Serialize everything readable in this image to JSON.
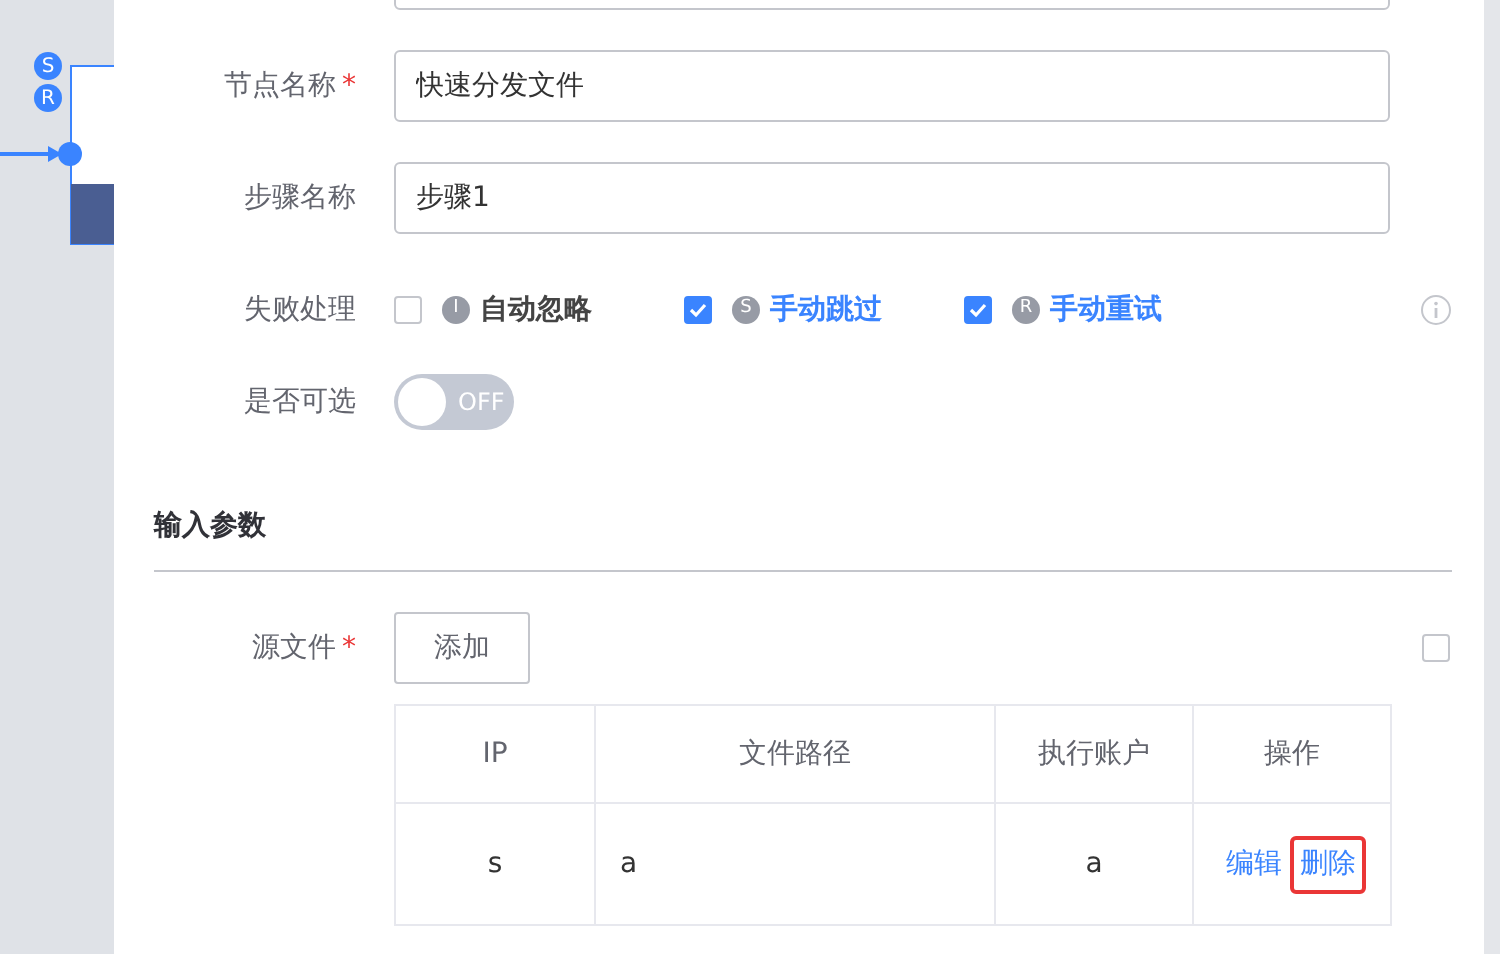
{
  "canvas": {
    "node_badges": [
      "S",
      "R"
    ]
  },
  "form": {
    "fields": [
      {
        "label": "节点名称",
        "required_mark": "*",
        "value": "快速分发文件"
      },
      {
        "label": "步骤名称",
        "value": "步骤1"
      }
    ],
    "failure": {
      "label": "失败处理",
      "options": [
        {
          "badge": "I",
          "label": "自动忽略",
          "checked": false
        },
        {
          "badge": "S",
          "label": "手动跳过",
          "checked": true
        },
        {
          "badge": "R",
          "label": "手动重试",
          "checked": true
        }
      ]
    },
    "optional": {
      "label": "是否可选",
      "on": false,
      "text": "OFF"
    }
  },
  "input_section": {
    "title": "输入参数",
    "source": {
      "label": "源文件",
      "required_mark": "*",
      "add_button": "添加",
      "checked": false
    },
    "table": {
      "columns": [
        "IP",
        "文件路径",
        "执行账户",
        "操作"
      ],
      "rows": [
        {
          "cells": [
            "s",
            "a",
            "a"
          ],
          "actions": [
            {
              "label": "编辑",
              "highlighted": false
            },
            {
              "label": "删除",
              "highlighted": true
            }
          ]
        }
      ]
    }
  }
}
